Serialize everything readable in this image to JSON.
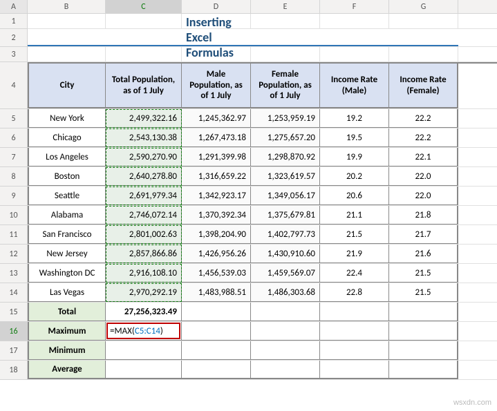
{
  "columns": [
    "A",
    "B",
    "C",
    "D",
    "E",
    "F",
    "G"
  ],
  "rows": [
    "1",
    "2",
    "3",
    "4",
    "5",
    "6",
    "7",
    "8",
    "9",
    "10",
    "11",
    "12",
    "13",
    "14",
    "15",
    "16",
    "17",
    "18"
  ],
  "title": "Inserting Excel Formulas",
  "headers": {
    "city": "City",
    "total_pop": "Total Population, as of 1 July",
    "male_pop": "Male Population, as of 1 July",
    "female_pop": "Female Population, as of 1 July",
    "income_m": "Income Rate (Male)",
    "income_f": "Income Rate (Female)"
  },
  "data": [
    {
      "city": "New York",
      "total": "2,499,322.16",
      "male": "1,245,362.97",
      "female": "1,253,959.19",
      "im": "19.2",
      "if": "22.2"
    },
    {
      "city": "Chicago",
      "total": "2,543,130.38",
      "male": "1,267,473.18",
      "female": "1,275,657.20",
      "im": "19.5",
      "if": "22.2"
    },
    {
      "city": "Los Angeles",
      "total": "2,590,270.90",
      "male": "1,291,399.98",
      "female": "1,298,870.92",
      "im": "19.9",
      "if": "22.1"
    },
    {
      "city": "Boston",
      "total": "2,640,278.80",
      "male": "1,316,659.22",
      "female": "1,323,619.57",
      "im": "20.2",
      "if": "22.0"
    },
    {
      "city": "Seattle",
      "total": "2,691,979.34",
      "male": "1,342,923.17",
      "female": "1,349,056.17",
      "im": "20.6",
      "if": "22.0"
    },
    {
      "city": "Alabama",
      "total": "2,746,072.14",
      "male": "1,370,392.34",
      "female": "1,375,679.81",
      "im": "21.1",
      "if": "21.8"
    },
    {
      "city": "San Francisco",
      "total": "2,801,002.63",
      "male": "1,398,204.90",
      "female": "1,402,797.73",
      "im": "21.5",
      "if": "21.7"
    },
    {
      "city": "New Jersey",
      "total": "2,857,866.86",
      "male": "1,426,956.26",
      "female": "1,430,910.60",
      "im": "21.9",
      "if": "21.6"
    },
    {
      "city": "Washington DC",
      "total": "2,916,108.10",
      "male": "1,456,539.03",
      "female": "1,459,569.07",
      "im": "22.4",
      "if": "21.5"
    },
    {
      "city": "Las Vegas",
      "total": "2,970,292.19",
      "male": "1,483,988.51",
      "female": "1,486,303.68",
      "im": "22.8",
      "if": "21.5"
    }
  ],
  "summary": {
    "total_label": "Total",
    "total_value": "27,256,323.49",
    "max_label": "Maximum",
    "min_label": "Minimum",
    "avg_label": "Average"
  },
  "formula": {
    "prefix": "=MAX(",
    "ref": "C5:C14",
    "suffix": ")"
  },
  "watermark": "wsxdn.com",
  "chart_data": {
    "type": "table",
    "title": "Inserting Excel Formulas",
    "columns": [
      "City",
      "Total Population, as of 1 July",
      "Male Population, as of 1 July",
      "Female Population, as of 1 July",
      "Income Rate (Male)",
      "Income Rate (Female)"
    ],
    "rows": [
      [
        "New York",
        2499322.16,
        1245362.97,
        1253959.19,
        19.2,
        22.2
      ],
      [
        "Chicago",
        2543130.38,
        1267473.18,
        1275657.2,
        19.5,
        22.2
      ],
      [
        "Los Angeles",
        2590270.9,
        1291399.98,
        1298870.92,
        19.9,
        22.1
      ],
      [
        "Boston",
        2640278.8,
        1316659.22,
        1323619.57,
        20.2,
        22.0
      ],
      [
        "Seattle",
        2691979.34,
        1342923.17,
        1349056.17,
        20.6,
        22.0
      ],
      [
        "Alabama",
        2746072.14,
        1370392.34,
        1375679.81,
        21.1,
        21.8
      ],
      [
        "San Francisco",
        2801002.63,
        1398204.9,
        1402797.73,
        21.5,
        21.7
      ],
      [
        "New Jersey",
        2857866.86,
        1426956.26,
        1430910.6,
        21.9,
        21.6
      ],
      [
        "Washington DC",
        2916108.1,
        1456539.03,
        1459569.07,
        22.4,
        21.5
      ],
      [
        "Las Vegas",
        2970292.19,
        1483988.51,
        1486303.68,
        22.8,
        21.5
      ]
    ],
    "summary": {
      "Total": 27256323.49
    }
  }
}
